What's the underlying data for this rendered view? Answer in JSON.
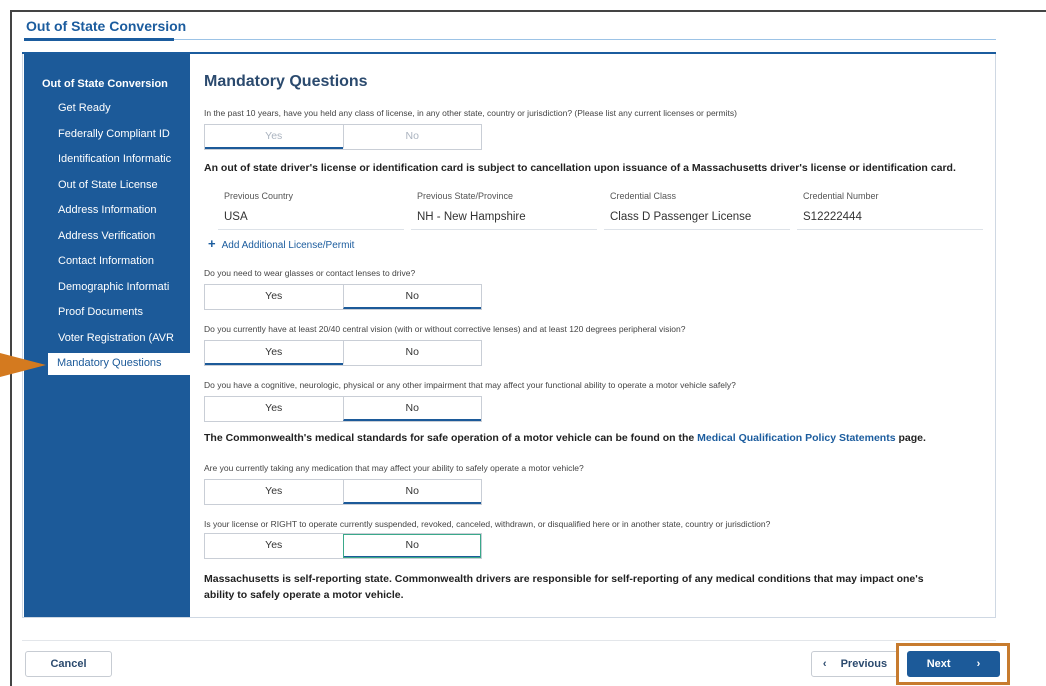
{
  "page": {
    "title": "Out of State Conversion"
  },
  "sidebar": {
    "heading": "Out of State Conversion",
    "items": [
      {
        "label": "Get Ready"
      },
      {
        "label": "Federally Compliant ID"
      },
      {
        "label": "Identification Informatic"
      },
      {
        "label": "Out of State License"
      },
      {
        "label": "Address Information"
      },
      {
        "label": "Address Verification"
      },
      {
        "label": "Contact Information"
      },
      {
        "label": "Demographic Informati"
      },
      {
        "label": "Proof Documents"
      },
      {
        "label": "Voter Registration (AVR"
      },
      {
        "label": "Mandatory Questions"
      }
    ],
    "active_index": 10
  },
  "main": {
    "heading": "Mandatory Questions",
    "q1": {
      "text": "In the past 10 years, have you held any class of license, in any other state, country or jurisdiction? (Please list any current licenses or permits)",
      "yes": "Yes",
      "no": "No",
      "selected": "Yes"
    },
    "cancellation_note": "An out of state driver's license or identification card is subject to cancellation upon issuance of a Massachusetts driver's license or identification card.",
    "license_table": {
      "headers": [
        "Previous Country",
        "Previous State/Province",
        "Credential Class",
        "Credential Number"
      ],
      "row": [
        "USA",
        "NH - New Hampshire",
        "Class D Passenger License",
        "S12222444"
      ]
    },
    "add_license_label": "Add Additional License/Permit",
    "q2": {
      "text": "Do you need to wear glasses or contact lenses to drive?",
      "yes": "Yes",
      "no": "No",
      "selected": "No"
    },
    "q3": {
      "text": "Do you currently have at least 20/40 central vision (with or without corrective lenses) and at least 120 degrees peripheral vision?",
      "yes": "Yes",
      "no": "No",
      "selected": "Yes"
    },
    "q4": {
      "text": "Do you have a cognitive, neurologic, physical or any other impairment that may affect your functional ability to operate a motor vehicle safely?",
      "yes": "Yes",
      "no": "No",
      "selected": "No"
    },
    "medical_note_prefix": "The Commonwealth's medical standards for safe operation of a motor vehicle can be found on the",
    "medical_note_link": "Medical Qualification Policy Statements",
    "medical_note_suffix": "page.",
    "q5": {
      "text": "Are you currently taking any medication that may affect your ability to safely operate a motor vehicle?",
      "yes": "Yes",
      "no": "No",
      "selected": "No"
    },
    "q6": {
      "text": "Is your license or RIGHT to operate currently suspended, revoked, canceled, withdrawn, or disqualified here or in another state, country or jurisdiction?",
      "yes": "Yes",
      "no": "No",
      "selected": "No"
    },
    "self_report_line1": "Massachusetts is self-reporting state. Commonwealth drivers are responsible for self-reporting of any medical conditions that may impact one's",
    "self_report_line2": "ability to safely operate a motor vehicle."
  },
  "footer": {
    "cancel": "Cancel",
    "previous": "Previous",
    "next": "Next",
    "prev_icon": "‹",
    "next_icon": "›"
  },
  "colors": {
    "brand_blue": "#1c5a99",
    "highlight_orange": "#d47a1f"
  }
}
